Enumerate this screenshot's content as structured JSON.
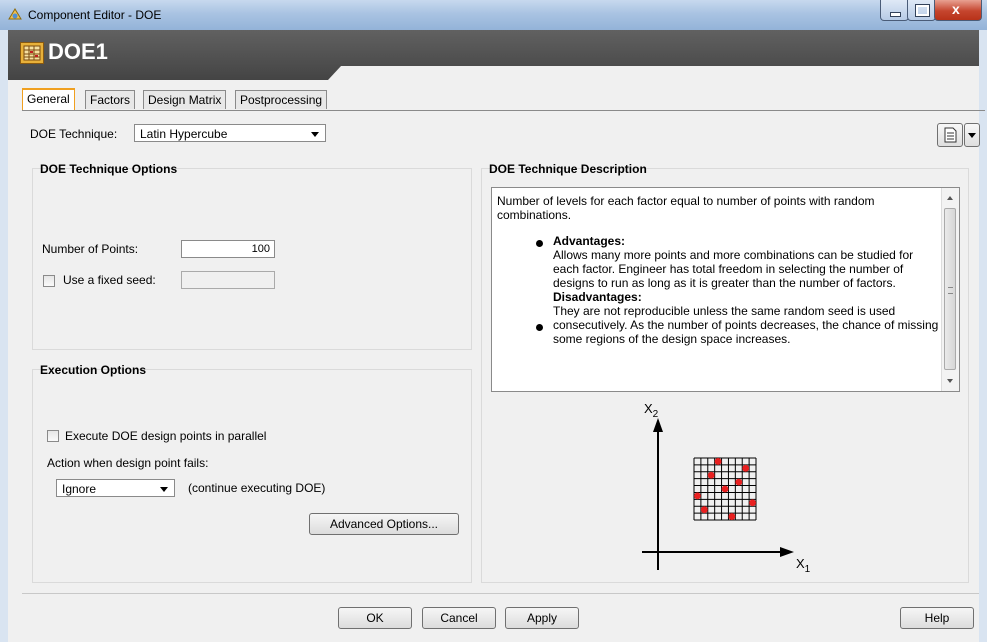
{
  "window": {
    "title": "Component Editor - DOE",
    "close_glyph": "x"
  },
  "banner": {
    "component_name": "DOE1",
    "icon": "doe-component-icon"
  },
  "tabs": [
    {
      "label": "General",
      "active": true
    },
    {
      "label": "Factors",
      "active": false
    },
    {
      "label": "Design Matrix",
      "active": false
    },
    {
      "label": "Postprocessing",
      "active": false
    }
  ],
  "general": {
    "technique_label": "DOE Technique:",
    "technique_value": "Latin Hypercube",
    "options_group": {
      "title": "DOE Technique Options",
      "points_label": "Number of Points:",
      "points_value": "100",
      "seed_label": "Use a fixed seed:",
      "seed_checked": false,
      "seed_value": ""
    },
    "execution_group": {
      "title": "Execution Options",
      "parallel_label": "Execute DOE design points in parallel",
      "parallel_checked": false,
      "fail_label": "Action when design point fails:",
      "fail_value": "Ignore",
      "fail_hint": "(continue executing DOE)",
      "advanced_button": "Advanced Options..."
    },
    "description_group": {
      "title": "DOE Technique Description",
      "intro": "Number of levels for each factor equal to number of points with random combinations.",
      "advantages_title": "Advantages:",
      "advantages_text": "Allows many more points and more combinations can be studied for each factor. Engineer has total freedom in selecting the number of designs to run as long as it is greater than the number of factors.",
      "disadvantages_title": "Disadvantages:",
      "disadvantages_text": "They are not reproducible unless the same random seed is used consecutively. As the number of points decreases, the chance of missing some regions of the design space increases.",
      "diagram": {
        "y_axis_label": "X2",
        "x_axis_label": "X1"
      }
    }
  },
  "footer": {
    "ok": "OK",
    "cancel": "Cancel",
    "apply": "Apply",
    "help": "Help"
  },
  "colors": {
    "accent_tab": "#f0a020",
    "banner": "#4f4f4f",
    "diagram_points": "#e82020"
  }
}
